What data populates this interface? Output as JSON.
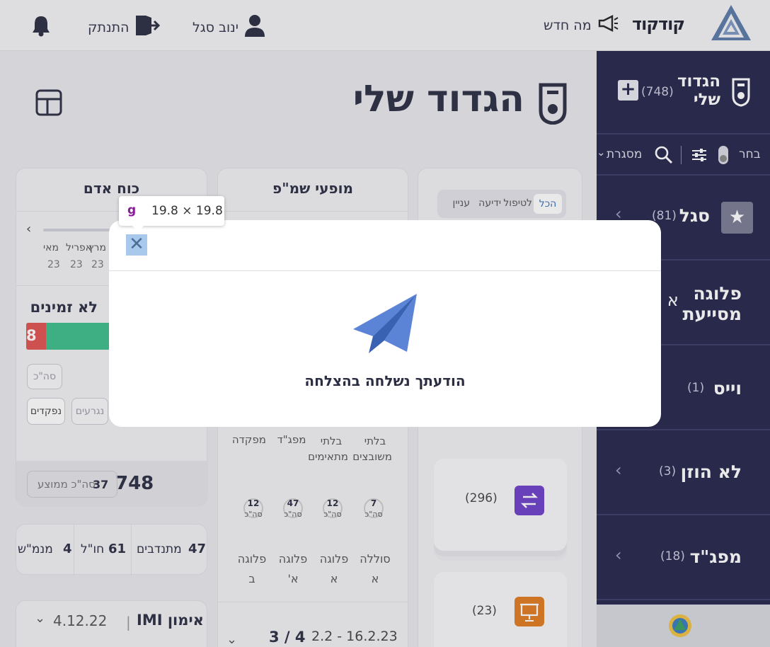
{
  "header": {
    "logo_text": "קודקוד",
    "whats_new": "מה חדש",
    "user_name": "ינוב סגל",
    "logout": "התנתק"
  },
  "sidebar": {
    "title": "הגדוד שלי",
    "count": "(748)",
    "plus": "+",
    "select": "בחר",
    "frame": "מסגרת",
    "items": [
      {
        "label": "סגל",
        "count": "(81)"
      },
      {
        "label": "פלוגה מסייעת",
        "count": ""
      },
      {
        "label": "וייס",
        "count": "(1)"
      },
      {
        "label": "לא הוזן",
        "count": "(3)"
      },
      {
        "label": "מפג\"ד",
        "count": "(18)"
      }
    ]
  },
  "main": {
    "title": "הגדוד שלי",
    "filters": [
      "הכל",
      "לטיפול",
      "ידיעה",
      "עניין"
    ],
    "event_counts": [
      "(296)",
      "(23)"
    ],
    "shamap_title": "מופעי שמ\"פ",
    "shamap_cols": [
      "בלתי משובצים",
      "בלתי מתאימים",
      "מפג\"ד",
      "מפקדה"
    ],
    "shamap_stats": [
      {
        "value": "7",
        "label": "סה\"כ"
      },
      {
        "value": "12",
        "label": "סה\"כ"
      },
      {
        "value": "47",
        "label": "סה\"כ"
      },
      {
        "value": "12",
        "label": "סה\"כ"
      }
    ],
    "shamap_units": [
      "סוללה א",
      "פלוגה א",
      "פלוגה א'",
      "פלוגה ב"
    ],
    "shamap_pager": "3 / 4",
    "shamap_dates": "2.2 - 16.2.23",
    "manpower_title": "כוח אדם",
    "months": [
      "מאי",
      "אפריל",
      "מרץ"
    ],
    "month_year": "23",
    "unavailable": "לא זמינים",
    "bar_value": "8",
    "pill_total": "סה\"כ",
    "pill_recruits": "נגרעים",
    "pill_absent": "נפקדים",
    "total": "748",
    "avg_value": "37",
    "avg_label": "סה\"כ ממוצע",
    "volunteers_value": "47",
    "volunteers_label": "מתנדבים",
    "abroad_value": "61",
    "abroad_label": "חו\"ל",
    "mnamash_value": "4",
    "mnamash_label": "מנמ\"ש",
    "training": "אימון IMI",
    "training_date": "4.12.22"
  },
  "modal": {
    "message": "הודעתך נשלחה בהצלחה",
    "close": "✕"
  },
  "tooltip": {
    "tag": "g",
    "dims": "19.8 × 19.8"
  },
  "colors": {
    "sidebar_bg": "#25264a",
    "bar_green": "#3dbd8a",
    "bar_red": "#e0534f",
    "plane_blue": "#4a72c8",
    "purple": "#6c3fc9",
    "orange": "#e07a1f"
  }
}
